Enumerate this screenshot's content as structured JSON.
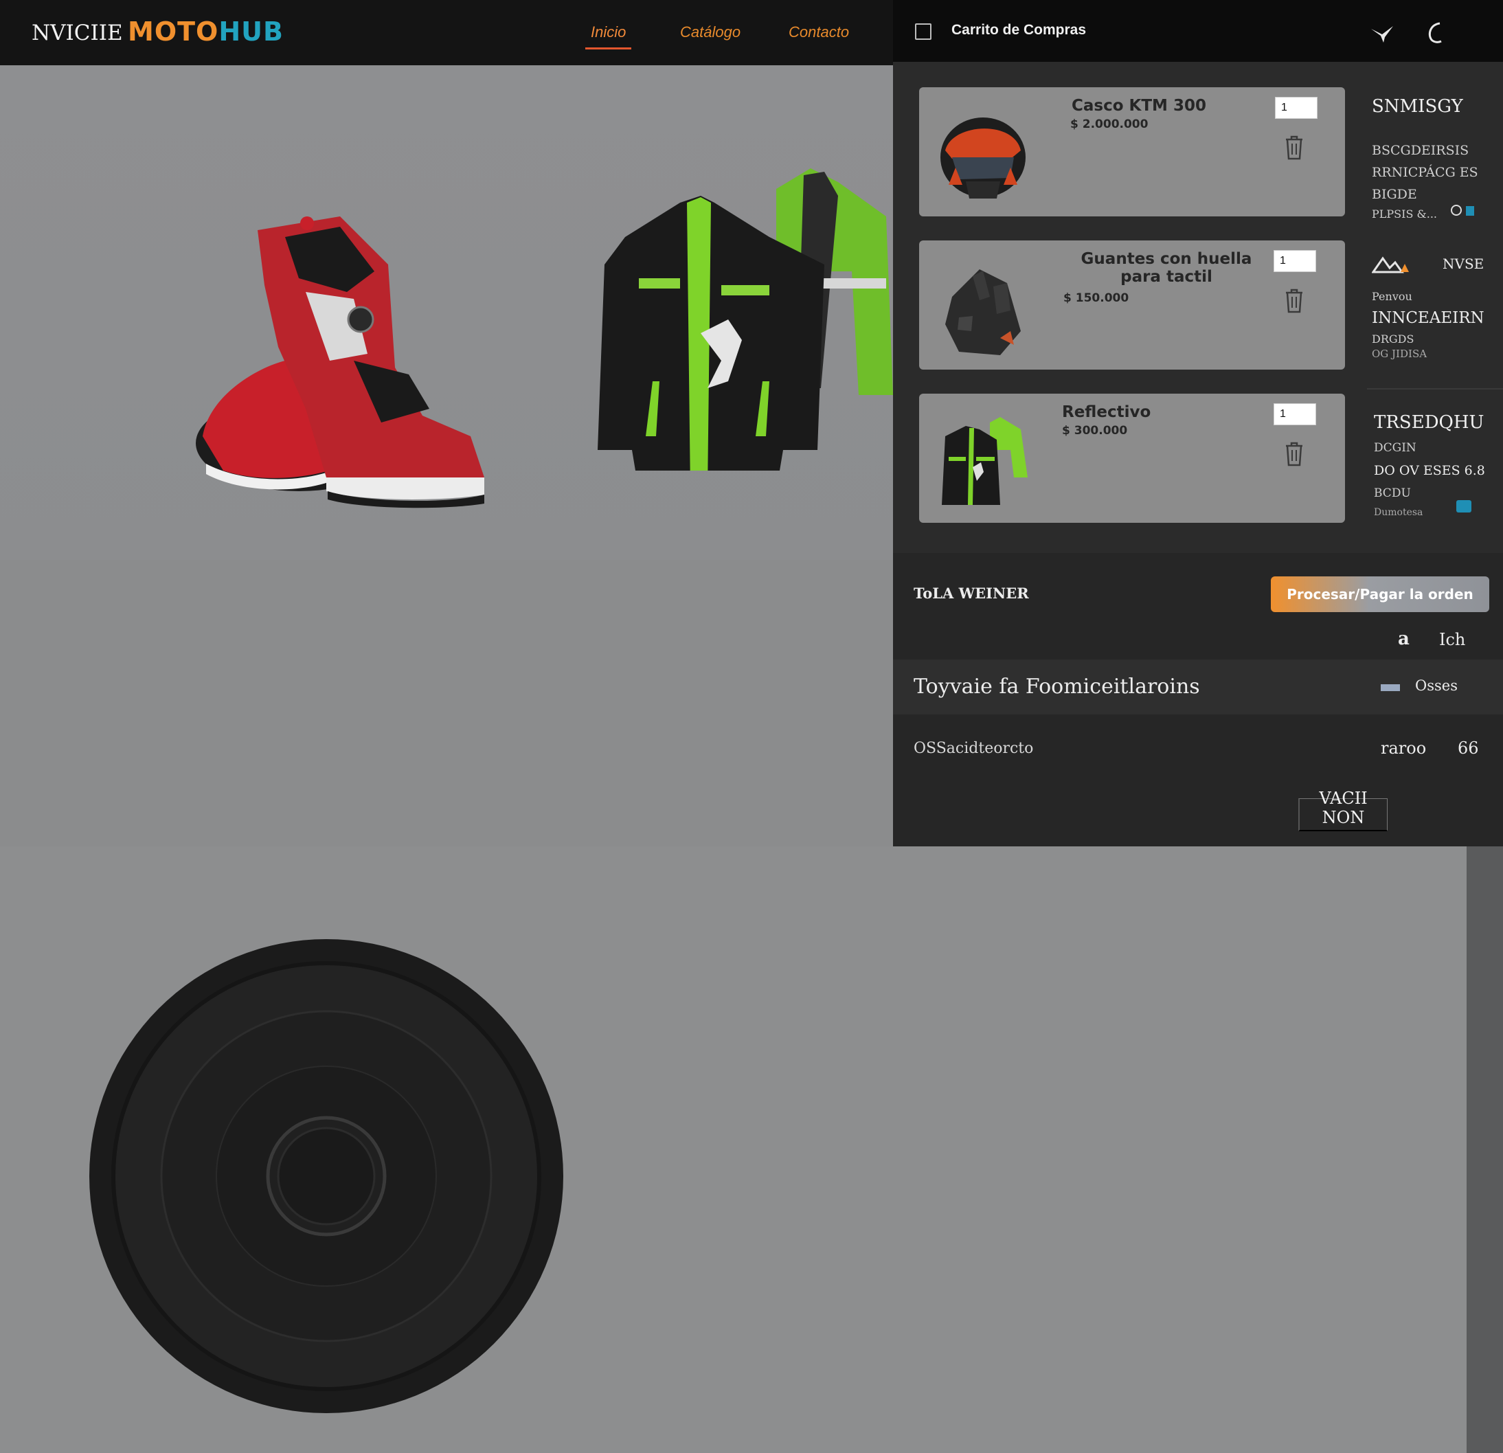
{
  "nav": {
    "prefix": "NVICIIE",
    "logo_part1": "MOTO",
    "logo_part2": "HUB",
    "links": [
      "Inicio",
      "Catálogo",
      "Contacto"
    ]
  },
  "cart": {
    "title": "Carrito de Compras",
    "items": [
      {
        "name": "Casco KTM 300",
        "price": "$ 2.000.000",
        "qty": "1"
      },
      {
        "name": "Guantes con huella para tactil",
        "price": "$ 150.000",
        "qty": "1"
      },
      {
        "name": "Reflectivo",
        "price": "$ 300.000",
        "qty": "1"
      }
    ],
    "side": {
      "block1": [
        "SNMISGY",
        "BSCGDEIRSIS",
        "RRNICPÁCG ES",
        "BIGDE",
        "PLPSIS &..."
      ],
      "block2": [
        "NVSE",
        "Penvou",
        "INNCEAEIRN",
        "DRGDS",
        "OG JIDISA"
      ],
      "block3": [
        "TRSEDQHU",
        "DCGIN",
        "DO OV ESES 6.8",
        "BCDU",
        "Dumotesa"
      ]
    },
    "footer": {
      "total_label": "ToLA WEINER",
      "checkout_label": "Procesar/Pagar la orden",
      "counter_a": "a",
      "counter_b": "Ich",
      "promo_text": "Toyvaie fa Foomiceitlaroins",
      "promo_value": "Osses",
      "subtotal_label": "OSSacidteorcto",
      "subtotal_value_a": "raroo",
      "subtotal_value_b": "66",
      "empty_label": "VACII NON"
    }
  },
  "colors": {
    "accent_orange": "#f0902e",
    "accent_teal": "#22a3bf",
    "nav_bg": "#141414",
    "cart_bg": "#2b2b2b",
    "card_bg": "#8c8c8c"
  }
}
